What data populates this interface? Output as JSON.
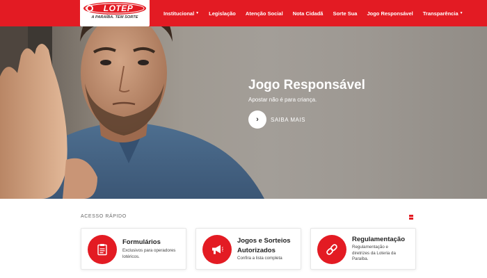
{
  "brand": {
    "logo_text": "LOTEP",
    "tagline": "A PARAÍBA. TEM SORTE",
    "colors": {
      "primary": "#e31b23",
      "white": "#ffffff"
    }
  },
  "nav": {
    "items": [
      {
        "label": "Institucional",
        "has_dropdown": true
      },
      {
        "label": "Legislação",
        "has_dropdown": false
      },
      {
        "label": "Atenção Social",
        "has_dropdown": false
      },
      {
        "label": "Nota Cidadã",
        "has_dropdown": false
      },
      {
        "label": "Sorte Sua",
        "has_dropdown": false
      },
      {
        "label": "Jogo Responsável",
        "has_dropdown": false
      },
      {
        "label": "Transparência",
        "has_dropdown": true
      }
    ]
  },
  "hero": {
    "title": "Jogo Responsável",
    "subtitle": "Apostar não é para criança.",
    "button_label": "SAIBA MAIS",
    "button_icon": "chevron-right-icon"
  },
  "quick_access": {
    "label": "ACESSO RÁPIDO",
    "view_icon": "grid-icon",
    "cards": [
      {
        "title": "Formulários",
        "description": "Exclusivos para operadores lotéricos.",
        "icon": "clipboard-icon"
      },
      {
        "title": "Jogos e Sorteios Autorizados",
        "description": "Confira a lista completa",
        "icon": "megaphone-icon"
      },
      {
        "title": "Regulamentação",
        "description": "Regulamentação e diretrizes da Loteria da Paraíba.",
        "icon": "link-icon"
      }
    ]
  }
}
